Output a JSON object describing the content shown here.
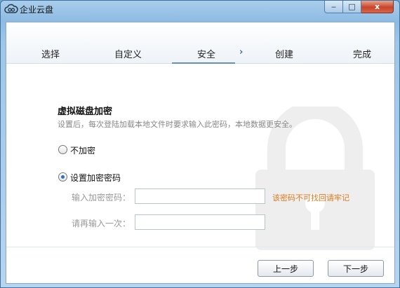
{
  "window": {
    "title": "企业云盘",
    "minimize_glyph": "‒",
    "maximize_glyph": "□",
    "close_glyph": "x"
  },
  "steps": [
    {
      "label": "选择"
    },
    {
      "label": "自定义"
    },
    {
      "label": "安全"
    },
    {
      "label": "创建"
    },
    {
      "label": "完成"
    }
  ],
  "step_arrow": "›",
  "section": {
    "title": "虚拟磁盘加密",
    "description": "设置后，每次登陆加载本地文件时要求输入此密码，本地数据更安全。"
  },
  "options": {
    "no_encrypt_label": "不加密",
    "set_password_label": "设置加密密码"
  },
  "fields": {
    "password_label": "输入加密密码：",
    "confirm_label": "请再输入一次：",
    "warning": "该密码不可找回请牢记"
  },
  "buttons": {
    "prev": "上一步",
    "next": "下一步"
  },
  "colors": {
    "accent": "#2a6fc0",
    "warning": "#e07a1b",
    "titlebar": "#8dbbe3"
  }
}
